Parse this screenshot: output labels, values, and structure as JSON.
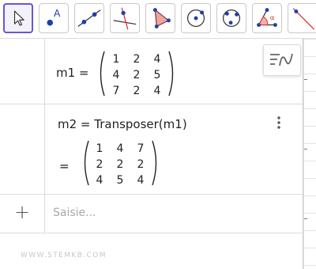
{
  "toolbar": {
    "tools": [
      {
        "name": "move-tool",
        "icon": "arrow-cursor-icon",
        "active": true
      },
      {
        "name": "point-tool",
        "icon": "point-A-icon",
        "label": "A"
      },
      {
        "name": "line-tool",
        "icon": "line-two-points-icon"
      },
      {
        "name": "perpendicular-line-tool",
        "icon": "perpendicular-line-icon"
      },
      {
        "name": "polygon-tool",
        "icon": "polygon-icon"
      },
      {
        "name": "circle-center-point-tool",
        "icon": "circle-center-icon"
      },
      {
        "name": "circle-three-points-tool",
        "icon": "circle-points-icon"
      },
      {
        "name": "angle-tool",
        "icon": "angle-alpha-icon",
        "label": "α"
      },
      {
        "name": "reflect-tool",
        "icon": "reflect-line-icon"
      }
    ],
    "accent_color": "#6557d2"
  },
  "algebra": {
    "m1": {
      "label": "m1 =",
      "matrix": [
        [
          "1",
          "2",
          "4"
        ],
        [
          "4",
          "2",
          "5"
        ],
        [
          "7",
          "2",
          "4"
        ]
      ]
    },
    "m2": {
      "definition": "m2 = Transposer(m1)",
      "equals": "=",
      "matrix": [
        [
          "1",
          "4",
          "7"
        ],
        [
          "2",
          "2",
          "2"
        ],
        [
          "4",
          "5",
          "4"
        ]
      ],
      "menu_icon": "more-vertical-icon"
    },
    "input": {
      "plus": "+",
      "placeholder": "Saisie..."
    },
    "style_bar_icon": "graphics-style-icon"
  },
  "watermark": "WWW.STEMKB.COM"
}
